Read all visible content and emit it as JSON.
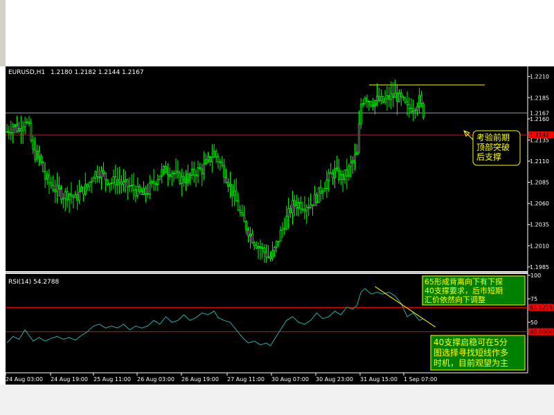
{
  "chart_data": [
    {
      "type": "candlestick",
      "symbol_label": "EURUSD,H1",
      "ohlc_label": "1.2180 1.2182 1.2144 1.2167",
      "ylim": [
        1.198,
        1.2222
      ],
      "y_ticks": [
        "1.2210",
        "1.2185",
        "1.2160",
        "1.2135",
        "1.2110",
        "1.2085",
        "1.2060",
        "1.2035",
        "1.2010",
        "1.1985"
      ],
      "y_tick_values": [
        1.221,
        1.2185,
        1.216,
        1.2135,
        1.211,
        1.2085,
        1.206,
        1.2035,
        1.201,
        1.1985
      ],
      "x_labels": [
        "24 Aug 03:00",
        "24 Aug 19:00",
        "25 Aug 11:00",
        "26 Aug 03:00",
        "26 Aug 19:00",
        "27 Aug 11:00",
        "30 Aug 07:00",
        "30 Aug 23:00",
        "31 Aug 15:00",
        "1 Sep 07:00"
      ],
      "bid_line": {
        "value": 1.2167,
        "label": "1.2167",
        "color": "#8aa0c8"
      },
      "support_line": {
        "value": 1.2141,
        "label": "1.2141",
        "color": "#ff0000"
      },
      "resistance_line": {
        "value": 1.22,
        "color": "#ffff00"
      },
      "annotation": "考验前期\n顶部突破\n后支撑",
      "candle_color": "#00ff00",
      "close_path": [
        [
          0,
          1.2145
        ],
        [
          3,
          1.2152
        ],
        [
          6,
          1.2148
        ],
        [
          9,
          1.216
        ],
        [
          11,
          1.2148
        ],
        [
          13,
          1.212
        ],
        [
          16,
          1.2115
        ],
        [
          19,
          1.209
        ],
        [
          22,
          1.2082
        ],
        [
          25,
          1.2075
        ],
        [
          28,
          1.207
        ],
        [
          31,
          1.2072
        ],
        [
          34,
          1.2065
        ],
        [
          37,
          1.2075
        ],
        [
          40,
          1.208
        ],
        [
          43,
          1.2095
        ],
        [
          46,
          1.2098
        ],
        [
          49,
          1.209
        ],
        [
          52,
          1.2085
        ],
        [
          55,
          1.2088
        ],
        [
          58,
          1.2082
        ],
        [
          61,
          1.208
        ],
        [
          64,
          1.2075
        ],
        [
          67,
          1.207
        ],
        [
          70,
          1.2075
        ],
        [
          73,
          1.2085
        ],
        [
          76,
          1.2095
        ],
        [
          79,
          1.21
        ],
        [
          82,
          1.2098
        ],
        [
          85,
          1.209
        ],
        [
          88,
          1.2088
        ],
        [
          91,
          1.2092
        ],
        [
          94,
          1.2098
        ],
        [
          97,
          1.21
        ],
        [
          100,
          1.211
        ],
        [
          103,
          1.212
        ],
        [
          105,
          1.2112
        ],
        [
          108,
          1.2098
        ],
        [
          111,
          1.208
        ],
        [
          114,
          1.2062
        ],
        [
          117,
          1.204
        ],
        [
          120,
          1.2028
        ],
        [
          123,
          1.2015
        ],
        [
          126,
          1.2008
        ],
        [
          129,
          1.2
        ],
        [
          131,
          1.1995
        ],
        [
          133,
          1.2005
        ],
        [
          136,
          1.2025
        ],
        [
          139,
          1.2042
        ],
        [
          142,
          1.2058
        ],
        [
          145,
          1.206
        ],
        [
          148,
          1.2058
        ],
        [
          151,
          1.206
        ],
        [
          154,
          1.2068
        ],
        [
          157,
          1.208
        ],
        [
          160,
          1.209
        ],
        [
          163,
          1.2098
        ],
        [
          166,
          1.209
        ],
        [
          169,
          1.2095
        ],
        [
          172,
          1.211
        ],
        [
          174,
          1.2118
        ],
        [
          175,
          1.215
        ],
        [
          176,
          1.2178
        ],
        [
          178,
          1.2188
        ],
        [
          181,
          1.218
        ],
        [
          184,
          1.2182
        ],
        [
          187,
          1.218
        ],
        [
          190,
          1.2185
        ],
        [
          193,
          1.2188
        ],
        [
          196,
          1.2182
        ],
        [
          199,
          1.2172
        ],
        [
          202,
          1.2175
        ],
        [
          205,
          1.2182
        ],
        [
          207,
          1.2167
        ]
      ]
    },
    {
      "type": "line",
      "indicator_label": "RSI(14)",
      "indicator_value": "54.2788",
      "ylim": [
        0,
        100
      ],
      "y_ticks": [
        "100",
        "75",
        "50"
      ],
      "y_tick_values": [
        100,
        75,
        50
      ],
      "levels": [
        {
          "value": 65.9255,
          "label": "65.9255",
          "color": "#ff0000"
        },
        {
          "value": 40.0,
          "label": "40.0000",
          "color": "#ff0000"
        }
      ],
      "trendline": {
        "from": [
          183,
          88
        ],
        "to": [
          213,
          45
        ],
        "color": "#ffff00"
      },
      "series": [
        {
          "color": "#20b2aa",
          "values": [
            [
              0,
              28
            ],
            [
              3,
              35
            ],
            [
              6,
              32
            ],
            [
              9,
              42
            ],
            [
              11,
              36
            ],
            [
              13,
              30
            ],
            [
              16,
              34
            ],
            [
              19,
              30
            ],
            [
              22,
              33
            ],
            [
              25,
              35
            ],
            [
              28,
              32
            ],
            [
              31,
              34
            ],
            [
              34,
              31
            ],
            [
              37,
              36
            ],
            [
              40,
              40
            ],
            [
              43,
              46
            ],
            [
              46,
              48
            ],
            [
              49,
              44
            ],
            [
              52,
              46
            ],
            [
              55,
              44
            ],
            [
              58,
              48
            ],
            [
              61,
              42
            ],
            [
              64,
              46
            ],
            [
              67,
              44
            ],
            [
              70,
              46
            ],
            [
              73,
              52
            ],
            [
              76,
              48
            ],
            [
              79,
              56
            ],
            [
              82,
              50
            ],
            [
              85,
              52
            ],
            [
              88,
              58
            ],
            [
              91,
              52
            ],
            [
              94,
              55
            ],
            [
              97,
              60
            ],
            [
              100,
              58
            ],
            [
              103,
              62
            ],
            [
              105,
              55
            ],
            [
              108,
              52
            ],
            [
              111,
              50
            ],
            [
              114,
              42
            ],
            [
              117,
              34
            ],
            [
              120,
              28
            ],
            [
              123,
              30
            ],
            [
              126,
              26
            ],
            [
              129,
              28
            ],
            [
              131,
              25
            ],
            [
              133,
              32
            ],
            [
              136,
              42
            ],
            [
              139,
              52
            ],
            [
              142,
              56
            ],
            [
              145,
              50
            ],
            [
              148,
              48
            ],
            [
              151,
              52
            ],
            [
              154,
              60
            ],
            [
              157,
              54
            ],
            [
              160,
              56
            ],
            [
              163,
              62
            ],
            [
              166,
              58
            ],
            [
              169,
              66
            ],
            [
              172,
              64
            ],
            [
              174,
              68
            ],
            [
              176,
              82
            ],
            [
              178,
              86
            ],
            [
              181,
              80
            ],
            [
              184,
              82
            ],
            [
              187,
              80
            ],
            [
              190,
              82
            ],
            [
              193,
              78
            ],
            [
              196,
              70
            ],
            [
              199,
              56
            ],
            [
              202,
              60
            ],
            [
              205,
              52
            ],
            [
              207,
              54
            ]
          ]
        }
      ],
      "annotation_top": "65形成背离向下有下探\n40支撑要求，后市短期\n汇价依然向下调整",
      "annotation_bottom": "40支撑启稳可在5分\n图选择寻找短线作多\n时机，目前观望为主"
    }
  ]
}
